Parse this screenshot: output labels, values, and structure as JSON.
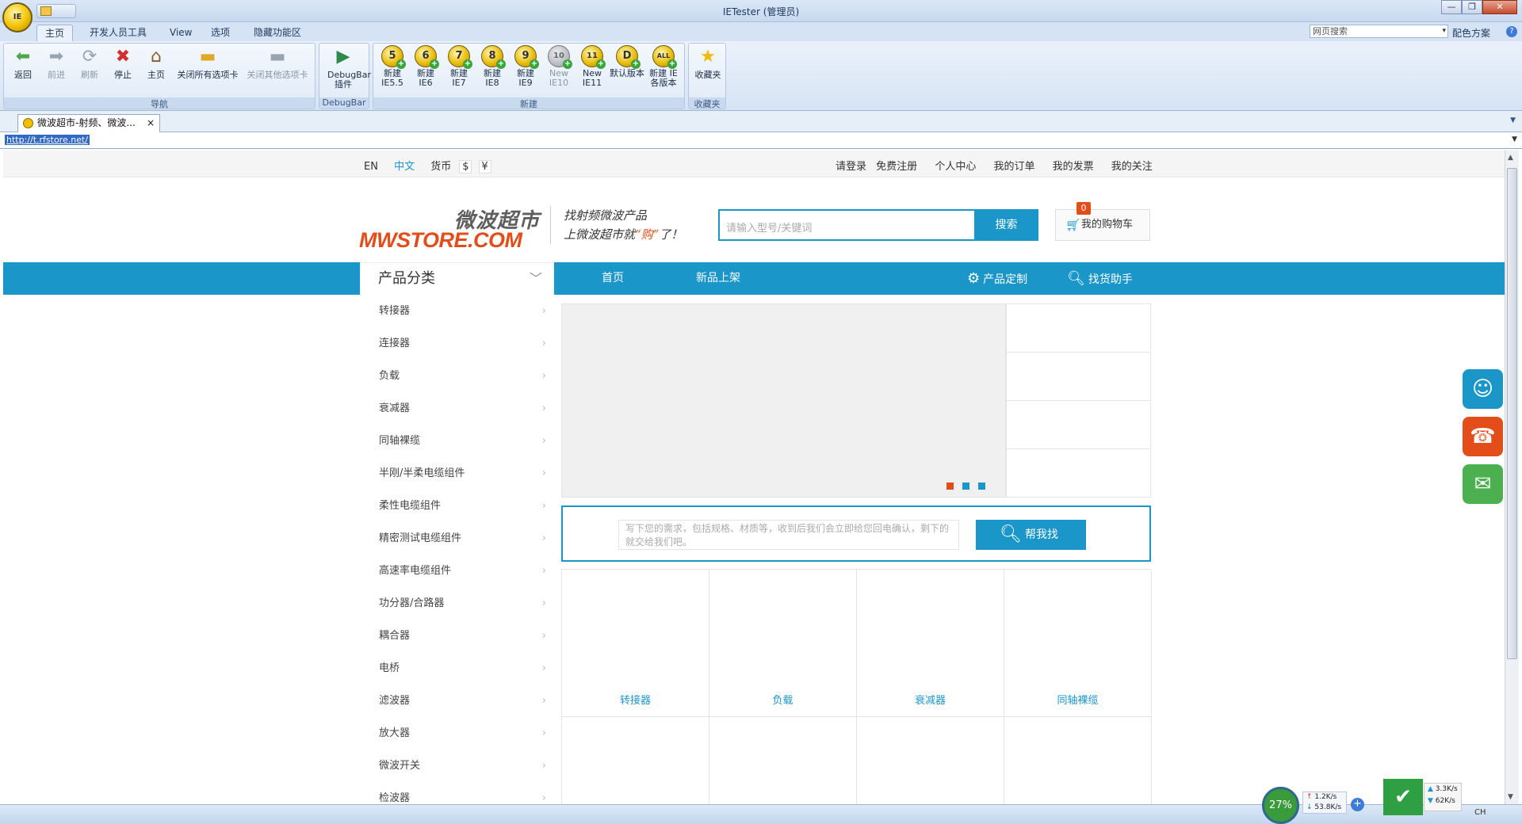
{
  "window": {
    "title": "IETester (管理员)",
    "orb_label": "IE",
    "controls": {
      "minimize": "—",
      "restore": "❐",
      "close": "✕"
    }
  },
  "ribbon_tabs": [
    {
      "label": "主页",
      "active": true
    },
    {
      "label": "开发人员工具"
    },
    {
      "label": "View"
    },
    {
      "label": "选项"
    },
    {
      "label": "隐藏功能区"
    }
  ],
  "ribbon_right": {
    "search_placeholder": "网页搜索",
    "scheme_label": "配色方案",
    "help": "?"
  },
  "groups": {
    "nav": {
      "name": "导航",
      "buttons": [
        {
          "label": "返回",
          "icon": "back-arrow-icon",
          "glyph": "⬅"
        },
        {
          "label": "前进",
          "icon": "forward-arrow-icon",
          "glyph": "➡"
        },
        {
          "label": "刷新",
          "icon": "refresh-icon",
          "glyph": "⟳"
        },
        {
          "label": "停止",
          "icon": "stop-icon",
          "glyph": "✖"
        },
        {
          "label": "主页",
          "icon": "home-icon",
          "glyph": "⌂"
        },
        {
          "label": "关闭所有选项卡",
          "icon": "folder-icon",
          "glyph": "▭"
        },
        {
          "label": "关闭其他选项卡",
          "icon": "tab-icon",
          "glyph": "▭"
        }
      ]
    },
    "debugbar": {
      "name": "DebugBar",
      "button": "DebugBar\n插件"
    },
    "new": {
      "name": "新建",
      "buttons": [
        {
          "label": "新建\nIE5.5",
          "badge": "5"
        },
        {
          "label": "新建\nIE6",
          "badge": "6"
        },
        {
          "label": "新建\nIE7",
          "badge": "7"
        },
        {
          "label": "新建\nIE8",
          "badge": "8"
        },
        {
          "label": "新建\nIE9",
          "badge": "9"
        },
        {
          "label": "New\nIE10",
          "badge": "10"
        },
        {
          "label": "New\nIE11",
          "badge": "11"
        },
        {
          "label": "默认版本",
          "badge": "D"
        },
        {
          "label": "新建 IE\n各版本",
          "badge": "ALL"
        }
      ]
    },
    "fav": {
      "name": "收藏夹",
      "button": "收藏夹"
    }
  },
  "doc_tab": {
    "label": "微波超市-射频、微波...",
    "close": "×"
  },
  "address": {
    "url": "http://t.rfstore.net/"
  },
  "site": {
    "topbar": {
      "lang_en": "EN",
      "lang_cn": "中文",
      "currency_label": "货币",
      "currency_usd": "$",
      "currency_cny": "¥",
      "links": [
        "请登录",
        "免费注册",
        "个人中心",
        "我的订单",
        "我的发票",
        "我的关注"
      ]
    },
    "logo_cn": "微波超市",
    "logo_en": "MWSTORE.COM",
    "slogan_1": "找射频微波产品",
    "slogan_2a": "上微波超市就",
    "slogan_2b": "“购”",
    "slogan_2c": "了！",
    "search_placeholder": "请输入型号/关键词",
    "search_button": "搜索",
    "cart_label": "我的购物车",
    "cart_count": "0",
    "category_title": "产品分类",
    "nav": [
      "首页",
      "新品上架",
      "产品定制",
      "找货助手"
    ],
    "categories": [
      "转接器",
      "连接器",
      "负载",
      "衰减器",
      "同轴裸缆",
      "半刚/半柔电缆组件",
      "柔性电缆组件",
      "精密测试电缆组件",
      "高速率电缆组件",
      "功分器/合路器",
      "耦合器",
      "电桥",
      "滤波器",
      "放大器",
      "微波开关",
      "检波器"
    ],
    "help_placeholder": "写下您的需求，包括规格、材质等，收到后我们会立即给您回电确认，剩下的就交给我们吧。",
    "help_button": "帮我找",
    "grid": [
      "转接器",
      "负载",
      "衰减器",
      "同轴裸缆"
    ]
  },
  "status": {
    "cpu": "27%",
    "up": "1.2K/s",
    "down": "53.8K/s",
    "wall_up": "3.3K/s",
    "wall_down": "62K/s",
    "ime": "CH"
  },
  "colors": {
    "brand_blue": "#1a96c8",
    "brand_orange": "#e24d1a"
  }
}
